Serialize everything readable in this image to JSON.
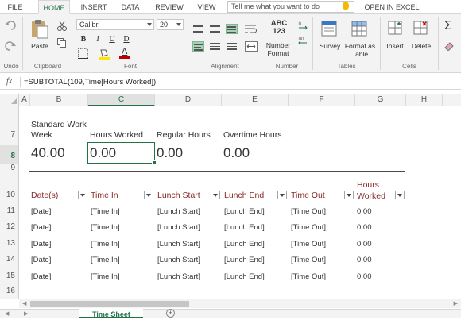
{
  "ribbon_tabs": [
    "FILE",
    "HOME",
    "INSERT",
    "DATA",
    "REVIEW",
    "VIEW"
  ],
  "active_tab": "HOME",
  "tell_me_placeholder": "Tell me what you want to do",
  "open_in_excel": "OPEN IN EXCEL",
  "ribbon": {
    "undo_group": "Undo",
    "clipboard_group": "Clipboard",
    "paste_label": "Paste",
    "font_group": "Font",
    "font_name": "Calibri",
    "font_size": "20",
    "bold": "B",
    "italic": "I",
    "underline": "U",
    "double_underline": "D",
    "font_color": "A",
    "alignment_group": "Alignment",
    "number_icon_text": "ABC\n123",
    "number_format_label": "Number Format",
    "number_group": "Number",
    "survey_label": "Survey",
    "format_as_table_label": "Format as Table",
    "tables_group": "Tables",
    "insert_label": "Insert",
    "delete_label": "Delete",
    "cells_group": "Cells",
    "sum_icon": "Σ"
  },
  "formula_bar": {
    "fx": "fx",
    "formula": "=SUBTOTAL(109,Time[Hours Worked])"
  },
  "columns": [
    "A",
    "B",
    "C",
    "D",
    "E",
    "F",
    "G",
    "H"
  ],
  "selected_column": "C",
  "rows": [
    "7",
    "8",
    "9",
    "10",
    "11",
    "12",
    "13",
    "14",
    "15",
    "16"
  ],
  "selected_row": "8",
  "summary": {
    "standard_work_week_label_line1": "Standard Work",
    "standard_work_week_label_line2": "Week",
    "standard_work_week_value": "40.00",
    "hours_worked_label": "Hours Worked",
    "hours_worked_value": "0.00",
    "regular_hours_label": "Regular Hours",
    "regular_hours_value": "0.00",
    "overtime_hours_label": "Overtime Hours",
    "overtime_hours_value": "0.00"
  },
  "table": {
    "headers": [
      "Date(s)",
      "Time In",
      "Lunch Start",
      "Lunch End",
      "Time Out",
      "Hours\nWorked"
    ],
    "header_color": "#8b2c2c",
    "rows": [
      [
        "[Date]",
        "[Time In]",
        "[Lunch Start]",
        "[Lunch End]",
        "[Time Out]",
        "0.00"
      ],
      [
        "[Date]",
        "[Time In]",
        "[Lunch Start]",
        "[Lunch End]",
        "[Time Out]",
        "0.00"
      ],
      [
        "[Date]",
        "[Time In]",
        "[Lunch Start]",
        "[Lunch End]",
        "[Time Out]",
        "0.00"
      ],
      [
        "[Date]",
        "[Time In]",
        "[Lunch Start]",
        "[Lunch End]",
        "[Time Out]",
        "0.00"
      ],
      [
        "[Date]",
        "[Time In]",
        "[Lunch Start]",
        "[Lunch End]",
        "[Time Out]",
        "0.00"
      ]
    ]
  },
  "sheet_tab": "Time Sheet",
  "add_sheet_icon": "+",
  "accent_color": "#217346"
}
